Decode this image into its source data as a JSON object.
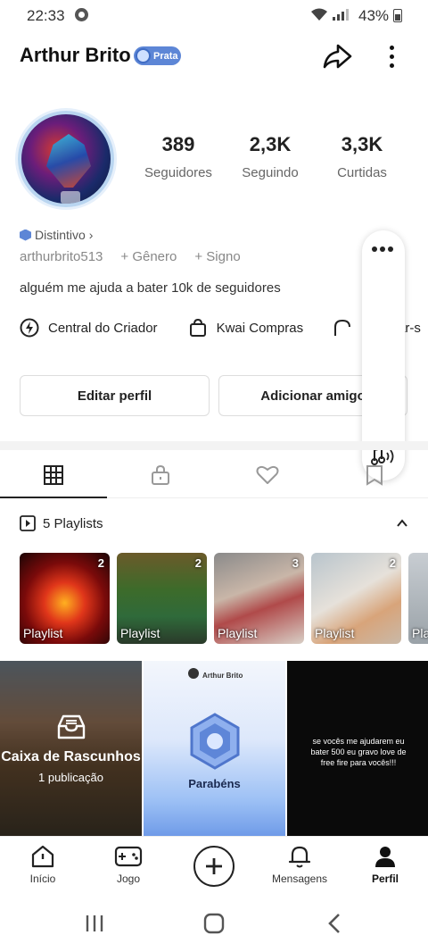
{
  "status_bar": {
    "time": "22:33",
    "battery": "43%"
  },
  "profile": {
    "name": "Arthur Brito",
    "badge": "Prata",
    "stats": [
      {
        "value": "389",
        "label": "Seguidores"
      },
      {
        "value": "2,3K",
        "label": "Seguindo"
      },
      {
        "value": "3,3K",
        "label": "Curtidas"
      }
    ],
    "distintivo": "Distintivo",
    "handle": "arthurbrito513",
    "gender": "+ Gênero",
    "sign": "+ Signo",
    "bio": "alguém me ajuda a bater 10k de seguidores"
  },
  "links": {
    "creator": "Central do Criador",
    "shop": "Kwai Compras",
    "third": "ar-s"
  },
  "buttons": {
    "edit": "Editar perfil",
    "add_friend": "Adicionar amigo"
  },
  "playlists": {
    "header": "5 Playlists",
    "items": [
      {
        "count": "2",
        "label": "Playlist"
      },
      {
        "count": "2",
        "label": "Playlist"
      },
      {
        "count": "3",
        "label": "Playlist"
      },
      {
        "count": "2",
        "label": "Playlist"
      },
      {
        "label": "Pla"
      }
    ]
  },
  "grid": {
    "drafts_title": "Caixa de Rascunhos",
    "drafts_sub": "1 publicação",
    "card_author": "Arthur Brito",
    "card_title": "Parabéns",
    "black_text": "se vocês me ajudarem eu bater 500 eu gravo love de free fire para vocês!!!"
  },
  "bottom_nav": [
    {
      "label": "Início"
    },
    {
      "label": "Jogo"
    },
    {
      "label": "Mensagens"
    },
    {
      "label": "Perfil"
    }
  ],
  "colors": {
    "badge": "#5d86d6",
    "accent_dark": "#222222"
  }
}
